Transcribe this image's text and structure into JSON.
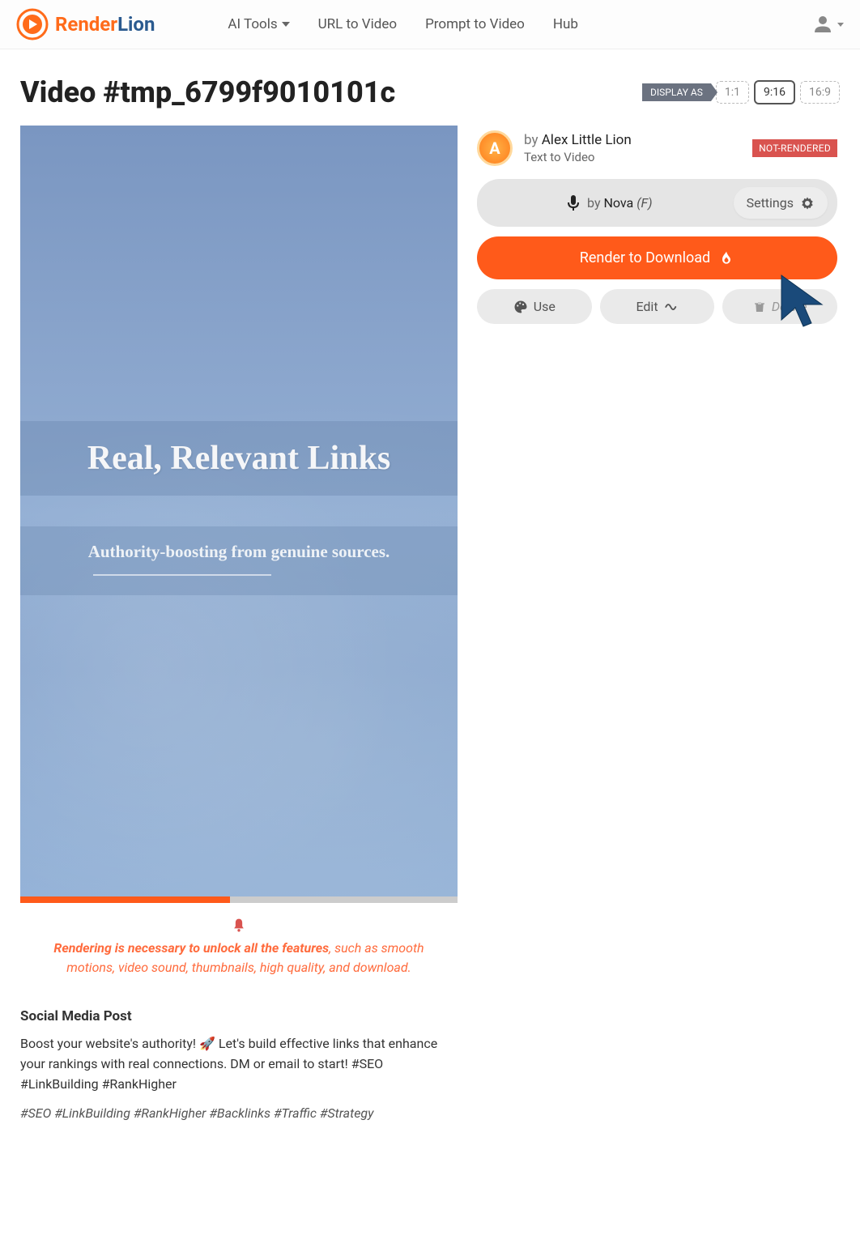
{
  "header": {
    "logo_render": "Render",
    "logo_lion": "Lion",
    "nav": [
      "AI Tools",
      "URL to Video",
      "Prompt to Video",
      "Hub"
    ]
  },
  "title": "Video #tmp_6799f9010101c",
  "display_as_label": "DISPLAY AS",
  "ratios": [
    "1:1",
    "9:16",
    "16:9"
  ],
  "preview": {
    "title": "Real, Relevant Links",
    "subtitle": "Authority-boosting from genuine sources."
  },
  "notice": {
    "bold": "Rendering is necessary to unlock all the features",
    "rest": ", such as smooth motions, video sound, thumbnails, high quality, and download."
  },
  "social": {
    "heading": "Social Media Post",
    "body": "Boost your website's authority! 🚀 Let's build effective links that enhance your rankings with real connections. DM or email to start! #SEO #LinkBuilding #RankHigher",
    "tags": "#SEO #LinkBuilding #RankHigher #Backlinks #Traffic #Strategy"
  },
  "author": {
    "by": "by ",
    "name": "Alex Little Lion",
    "sub": "Text to Video",
    "initial": "A"
  },
  "status": "NOT-RENDERED",
  "voice": {
    "by": "by ",
    "name": "Nova ",
    "suffix": "(F)",
    "settings": "Settings"
  },
  "render_label": "Render to Download",
  "actions": {
    "use": "Use",
    "edit": "Edit",
    "delete": "Delete"
  }
}
